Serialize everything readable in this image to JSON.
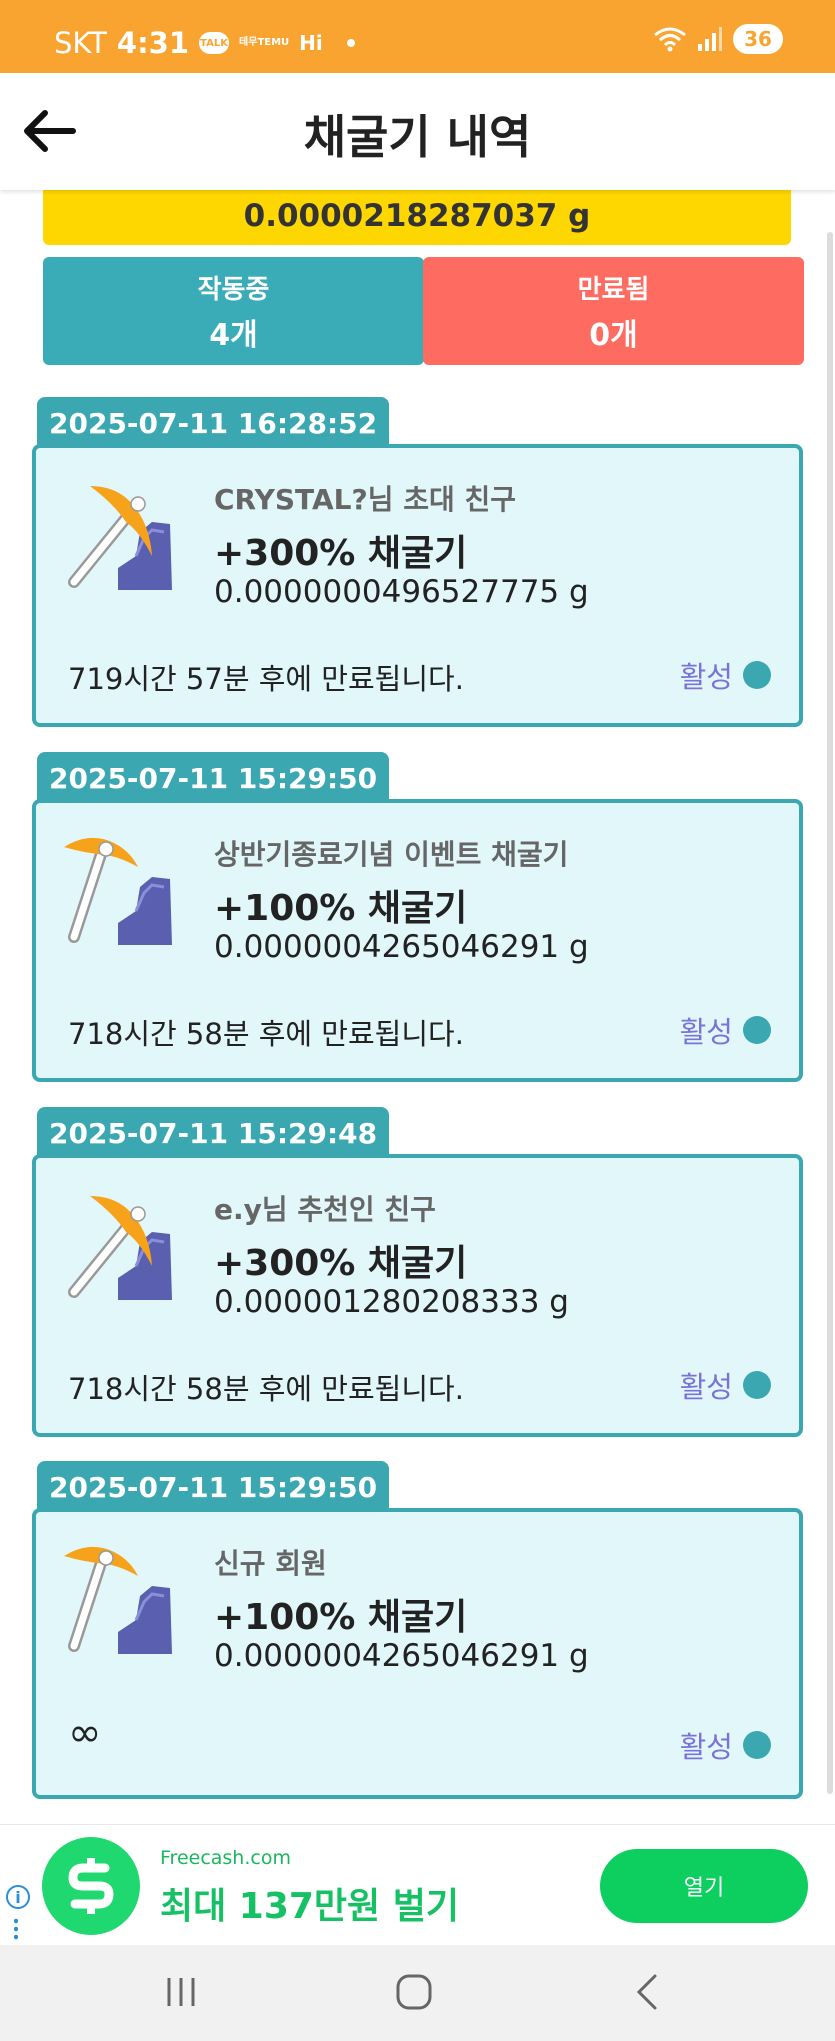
{
  "status_bar": {
    "carrier": "SKT",
    "time": "4:31",
    "talk_badge": "TALK",
    "temu_badge_top": "테무",
    "temu_badge_bottom": "TEMU",
    "hi_badge": "Hi",
    "battery": "36"
  },
  "header": {
    "title": "채굴기 내역"
  },
  "summary": {
    "total": "0.0000218287037 g",
    "active_label": "작동중",
    "active_count": "4개",
    "expired_label": "만료됨",
    "expired_count": "0개"
  },
  "miners": [
    {
      "date": "2025-07-11 16:28:52",
      "source": "CRYSTAL?님 초대 친구",
      "rate": "+300% 채굴기",
      "amount": "0.0000000496527775 g",
      "expiry": "719시간 57분 후에 만료됩니다.",
      "status": "활성"
    },
    {
      "date": "2025-07-11 15:29:50",
      "source": "상반기종료기념 이벤트 채굴기",
      "rate": "+100% 채굴기",
      "amount": "0.0000004265046291 g",
      "expiry": "718시간 58분 후에 만료됩니다.",
      "status": "활성"
    },
    {
      "date": "2025-07-11 15:29:48",
      "source": "e.y님 추천인 친구",
      "rate": "+300% 채굴기",
      "amount": "0.000001280208333 g",
      "expiry": "718시간 58분 후에 만료됩니다.",
      "status": "활성"
    },
    {
      "date": "2025-07-11 15:29:50",
      "source": "신규 회원",
      "rate": "+100% 채굴기",
      "amount": "0.0000004265046291 g",
      "expiry": "∞",
      "status": "활성"
    }
  ],
  "ad": {
    "domain": "Freecash.com",
    "headline": "최대 137만원 벌기",
    "button": "열기",
    "info_icon": "i"
  },
  "colors": {
    "status_bar": "#f9a431",
    "total_bar": "#ffd700",
    "active": "#3aacb7",
    "expired": "#fd6b61",
    "card_bg": "#e1f7fa",
    "card_border": "#3aa7b1",
    "status_text": "#7b73d8",
    "ad_green": "#0ccf60"
  },
  "icons": {
    "back": "arrow-left-icon",
    "miner": "pickaxe-icon",
    "nav_recents": "recents-icon",
    "nav_home": "home-icon",
    "nav_back": "back-chevron-icon"
  }
}
